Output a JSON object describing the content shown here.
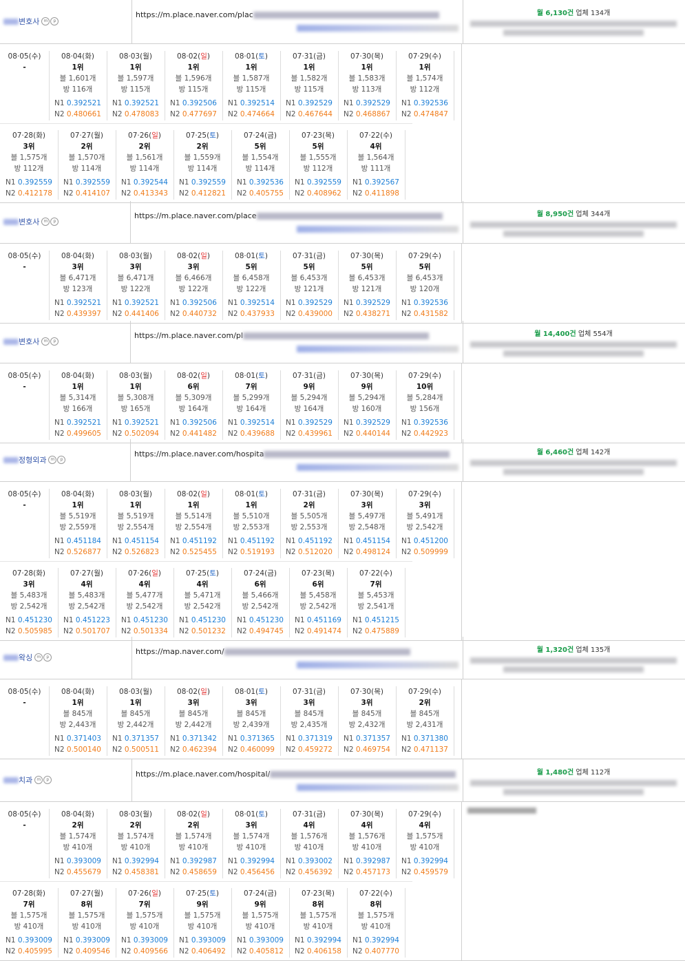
{
  "entries": [
    {
      "name_suffix": "변호사",
      "url": "https://m.place.naver.com/plac",
      "stat_month": "월 6,130건",
      "stat_biz": "업체 134개",
      "rows": [
        [
          {
            "date": "08·05(수)",
            "rank": "-"
          },
          {
            "date": "08·04(화)",
            "rank": "1위",
            "blog": "블 1,601개",
            "bang": "방 116개",
            "n1": "0.392521",
            "n2": "0.480661"
          },
          {
            "date": "08·03(월)",
            "rank": "1위",
            "blog": "블 1,597개",
            "bang": "방 115개",
            "n1": "0.392521",
            "n2": "0.478083"
          },
          {
            "date": "08·02(일)",
            "rank": "1위",
            "blog": "블 1,596개",
            "bang": "방 115개",
            "n1": "0.392506",
            "n2": "0.477697"
          },
          {
            "date": "08·01(토)",
            "rank": "1위",
            "blog": "블 1,587개",
            "bang": "방 115개",
            "n1": "0.392514",
            "n2": "0.474664"
          },
          {
            "date": "07·31(금)",
            "rank": "1위",
            "blog": "블 1,582개",
            "bang": "방 115개",
            "n1": "0.392529",
            "n2": "0.467644"
          },
          {
            "date": "07·30(목)",
            "rank": "1위",
            "blog": "블 1,583개",
            "bang": "방 113개",
            "n1": "0.392529",
            "n2": "0.468867"
          },
          {
            "date": "07·29(수)",
            "rank": "1위",
            "blog": "블 1,574개",
            "bang": "방 112개",
            "n1": "0.392536",
            "n2": "0.474847"
          }
        ],
        [
          {
            "date": "07·28(화)",
            "rank": "3위",
            "blog": "블 1,575개",
            "bang": "방 112개",
            "n1": "0.392559",
            "n2": "0.412178"
          },
          {
            "date": "07·27(월)",
            "rank": "2위",
            "blog": "블 1,570개",
            "bang": "방 114개",
            "n1": "0.392559",
            "n2": "0.414107"
          },
          {
            "date": "07·26(일)",
            "rank": "2위",
            "blog": "블 1,561개",
            "bang": "방 114개",
            "n1": "0.392544",
            "n2": "0.413343"
          },
          {
            "date": "07·25(토)",
            "rank": "2위",
            "blog": "블 1,559개",
            "bang": "방 114개",
            "n1": "0.392559",
            "n2": "0.412821"
          },
          {
            "date": "07·24(금)",
            "rank": "5위",
            "blog": "블 1,554개",
            "bang": "방 114개",
            "n1": "0.392536",
            "n2": "0.405755"
          },
          {
            "date": "07·23(목)",
            "rank": "5위",
            "blog": "블 1,555개",
            "bang": "방 112개",
            "n1": "0.392559",
            "n2": "0.408962"
          },
          {
            "date": "07·22(수)",
            "rank": "4위",
            "blog": "블 1,564개",
            "bang": "방 111개",
            "n1": "0.392567",
            "n2": "0.411898"
          }
        ]
      ]
    },
    {
      "name_suffix": "변호사",
      "url": "https://m.place.naver.com/place",
      "stat_month": "월 8,950건",
      "stat_biz": "업체 344개",
      "rows": [
        [
          {
            "date": "08·05(수)",
            "rank": "-"
          },
          {
            "date": "08·04(화)",
            "rank": "3위",
            "blog": "블 6,471개",
            "bang": "방 123개",
            "n1": "0.392521",
            "n2": "0.439397"
          },
          {
            "date": "08·03(월)",
            "rank": "3위",
            "blog": "블 6,471개",
            "bang": "방 122개",
            "n1": "0.392521",
            "n2": "0.441406"
          },
          {
            "date": "08·02(일)",
            "rank": "3위",
            "blog": "블 6,466개",
            "bang": "방 122개",
            "n1": "0.392506",
            "n2": "0.440732"
          },
          {
            "date": "08·01(토)",
            "rank": "5위",
            "blog": "블 6,458개",
            "bang": "방 122개",
            "n1": "0.392514",
            "n2": "0.437933"
          },
          {
            "date": "07·31(금)",
            "rank": "5위",
            "blog": "블 6,453개",
            "bang": "방 121개",
            "n1": "0.392529",
            "n2": "0.439000"
          },
          {
            "date": "07·30(목)",
            "rank": "5위",
            "blog": "블 6,453개",
            "bang": "방 121개",
            "n1": "0.392529",
            "n2": "0.438271"
          },
          {
            "date": "07·29(수)",
            "rank": "5위",
            "blog": "블 6,453개",
            "bang": "방 120개",
            "n1": "0.392536",
            "n2": "0.431582"
          }
        ]
      ]
    },
    {
      "name_suffix": "변호사",
      "url": "https://m.place.naver.com/pl",
      "stat_month": "월 14,400건",
      "stat_biz": "업체 554개",
      "rows": [
        [
          {
            "date": "08·05(수)",
            "rank": "-"
          },
          {
            "date": "08·04(화)",
            "rank": "1위",
            "blog": "블 5,314개",
            "bang": "방 166개",
            "n1": "0.392521",
            "n2": "0.499605"
          },
          {
            "date": "08·03(월)",
            "rank": "1위",
            "blog": "블 5,308개",
            "bang": "방 165개",
            "n1": "0.392521",
            "n2": "0.502094"
          },
          {
            "date": "08·02(일)",
            "rank": "6위",
            "blog": "블 5,309개",
            "bang": "방 164개",
            "n1": "0.392506",
            "n2": "0.441482"
          },
          {
            "date": "08·01(토)",
            "rank": "7위",
            "blog": "블 5,299개",
            "bang": "방 164개",
            "n1": "0.392514",
            "n2": "0.439688"
          },
          {
            "date": "07·31(금)",
            "rank": "9위",
            "blog": "블 5,294개",
            "bang": "방 164개",
            "n1": "0.392529",
            "n2": "0.439961"
          },
          {
            "date": "07·30(목)",
            "rank": "9위",
            "blog": "블 5,294개",
            "bang": "방 160개",
            "n1": "0.392529",
            "n2": "0.440144"
          },
          {
            "date": "07·29(수)",
            "rank": "10위",
            "blog": "블 5,284개",
            "bang": "방 156개",
            "n1": "0.392536",
            "n2": "0.442923"
          }
        ]
      ]
    },
    {
      "name_suffix": "정형외과",
      "url": "https://m.place.naver.com/hospita",
      "stat_month": "월 6,460건",
      "stat_biz": "업체 142개",
      "rows": [
        [
          {
            "date": "08·05(수)",
            "rank": "-"
          },
          {
            "date": "08·04(화)",
            "rank": "1위",
            "blog": "블 5,519개",
            "bang": "방 2,559개",
            "n1": "0.451184",
            "n2": "0.526877"
          },
          {
            "date": "08·03(월)",
            "rank": "1위",
            "blog": "블 5,519개",
            "bang": "방 2,554개",
            "n1": "0.451154",
            "n2": "0.526823"
          },
          {
            "date": "08·02(일)",
            "rank": "1위",
            "blog": "블 5,514개",
            "bang": "방 2,554개",
            "n1": "0.451192",
            "n2": "0.525455"
          },
          {
            "date": "08·01(토)",
            "rank": "1위",
            "blog": "블 5,510개",
            "bang": "방 2,553개",
            "n1": "0.451192",
            "n2": "0.519193"
          },
          {
            "date": "07·31(금)",
            "rank": "2위",
            "blog": "블 5,505개",
            "bang": "방 2,553개",
            "n1": "0.451192",
            "n2": "0.512020"
          },
          {
            "date": "07·30(목)",
            "rank": "3위",
            "blog": "블 5,497개",
            "bang": "방 2,548개",
            "n1": "0.451154",
            "n2": "0.498124"
          },
          {
            "date": "07·29(수)",
            "rank": "3위",
            "blog": "블 5,491개",
            "bang": "방 2,542개",
            "n1": "0.451200",
            "n2": "0.509999"
          }
        ],
        [
          {
            "date": "07·28(화)",
            "rank": "3위",
            "blog": "블 5,483개",
            "bang": "방 2,542개",
            "n1": "0.451230",
            "n2": "0.505985"
          },
          {
            "date": "07·27(월)",
            "rank": "4위",
            "blog": "블 5,483개",
            "bang": "방 2,542개",
            "n1": "0.451223",
            "n2": "0.501707"
          },
          {
            "date": "07·26(일)",
            "rank": "4위",
            "blog": "블 5,477개",
            "bang": "방 2,542개",
            "n1": "0.451230",
            "n2": "0.501334"
          },
          {
            "date": "07·25(토)",
            "rank": "4위",
            "blog": "블 5,471개",
            "bang": "방 2,542개",
            "n1": "0.451230",
            "n2": "0.501232"
          },
          {
            "date": "07·24(금)",
            "rank": "6위",
            "blog": "블 5,466개",
            "bang": "방 2,542개",
            "n1": "0.451230",
            "n2": "0.494745"
          },
          {
            "date": "07·23(목)",
            "rank": "6위",
            "blog": "블 5,458개",
            "bang": "방 2,542개",
            "n1": "0.451169",
            "n2": "0.491474"
          },
          {
            "date": "07·22(수)",
            "rank": "7위",
            "blog": "블 5,453개",
            "bang": "방 2,541개",
            "n1": "0.451215",
            "n2": "0.475889"
          }
        ]
      ]
    },
    {
      "name_suffix": "왁싱",
      "url": "https://map.naver.com/",
      "stat_month": "월 1,320건",
      "stat_biz": "업체 135개",
      "rows": [
        [
          {
            "date": "08·05(수)",
            "rank": "-"
          },
          {
            "date": "08·04(화)",
            "rank": "1위",
            "blog": "블 845개",
            "bang": "방 2,443개",
            "n1": "0.371403",
            "n2": "0.500140"
          },
          {
            "date": "08·03(월)",
            "rank": "1위",
            "blog": "블 845개",
            "bang": "방 2,442개",
            "n1": "0.371357",
            "n2": "0.500511"
          },
          {
            "date": "08·02(일)",
            "rank": "3위",
            "blog": "블 845개",
            "bang": "방 2,442개",
            "n1": "0.371342",
            "n2": "0.462394"
          },
          {
            "date": "08·01(토)",
            "rank": "3위",
            "blog": "블 845개",
            "bang": "방 2,439개",
            "n1": "0.371365",
            "n2": "0.460099"
          },
          {
            "date": "07·31(금)",
            "rank": "3위",
            "blog": "블 845개",
            "bang": "방 2,435개",
            "n1": "0.371319",
            "n2": "0.459272"
          },
          {
            "date": "07·30(목)",
            "rank": "3위",
            "blog": "블 845개",
            "bang": "방 2,432개",
            "n1": "0.371357",
            "n2": "0.469754"
          },
          {
            "date": "07·29(수)",
            "rank": "2위",
            "blog": "블 845개",
            "bang": "방 2,431개",
            "n1": "0.371380",
            "n2": "0.471137"
          }
        ]
      ]
    },
    {
      "name_suffix": "치과",
      "url": "https://m.place.naver.com/hospital/",
      "stat_month": "월 1,480건",
      "stat_biz": "업체 112개",
      "rows": [
        [
          {
            "date": "08·05(수)",
            "rank": "-"
          },
          {
            "date": "08·04(화)",
            "rank": "2위",
            "blog": "블 1,574개",
            "bang": "방 410개",
            "n1": "0.393009",
            "n2": "0.455679"
          },
          {
            "date": "08·03(월)",
            "rank": "2위",
            "blog": "블 1,574개",
            "bang": "방 410개",
            "n1": "0.392994",
            "n2": "0.458381"
          },
          {
            "date": "08·02(일)",
            "rank": "2위",
            "blog": "블 1,574개",
            "bang": "방 410개",
            "n1": "0.392987",
            "n2": "0.458659"
          },
          {
            "date": "08·01(토)",
            "rank": "3위",
            "blog": "블 1,574개",
            "bang": "방 410개",
            "n1": "0.392994",
            "n2": "0.456456"
          },
          {
            "date": "07·31(금)",
            "rank": "4위",
            "blog": "블 1,576개",
            "bang": "방 410개",
            "n1": "0.393002",
            "n2": "0.456392"
          },
          {
            "date": "07·30(목)",
            "rank": "4위",
            "blog": "블 1,576개",
            "bang": "방 410개",
            "n1": "0.392987",
            "n2": "0.457173"
          },
          {
            "date": "07·29(수)",
            "rank": "4위",
            "blog": "블 1,575개",
            "bang": "방 410개",
            "n1": "0.392994",
            "n2": "0.459579"
          }
        ],
        [
          {
            "date": "07·28(화)",
            "rank": "7위",
            "blog": "블 1,575개",
            "bang": "방 410개",
            "n1": "0.393009",
            "n2": "0.405995"
          },
          {
            "date": "07·27(월)",
            "rank": "8위",
            "blog": "블 1,575개",
            "bang": "방 410개",
            "n1": "0.393009",
            "n2": "0.409546"
          },
          {
            "date": "07·26(일)",
            "rank": "7위",
            "blog": "블 1,575개",
            "bang": "방 410개",
            "n1": "0.393009",
            "n2": "0.409566"
          },
          {
            "date": "07·25(토)",
            "rank": "9위",
            "blog": "블 1,575개",
            "bang": "방 410개",
            "n1": "0.393009",
            "n2": "0.406492"
          },
          {
            "date": "07·24(금)",
            "rank": "9위",
            "blog": "블 1,575개",
            "bang": "방 410개",
            "n1": "0.393009",
            "n2": "0.405812"
          },
          {
            "date": "07·23(목)",
            "rank": "8위",
            "blog": "블 1,575개",
            "bang": "방 410개",
            "n1": "0.392994",
            "n2": "0.406158"
          },
          {
            "date": "07·22(수)",
            "rank": "8위",
            "blog": "블 1,575개",
            "bang": "방 410개",
            "n1": "0.392994",
            "n2": "0.407770"
          }
        ]
      ]
    }
  ],
  "labels": {
    "n1": "N1",
    "n2": "N2",
    "icon_m": "m",
    "icon_p": "p"
  },
  "colors": {
    "n1": "#1c7ed6",
    "n2": "#f07c1a",
    "month": "#1a9c4a",
    "sat": "#1f66c8",
    "sun": "#e23030"
  }
}
